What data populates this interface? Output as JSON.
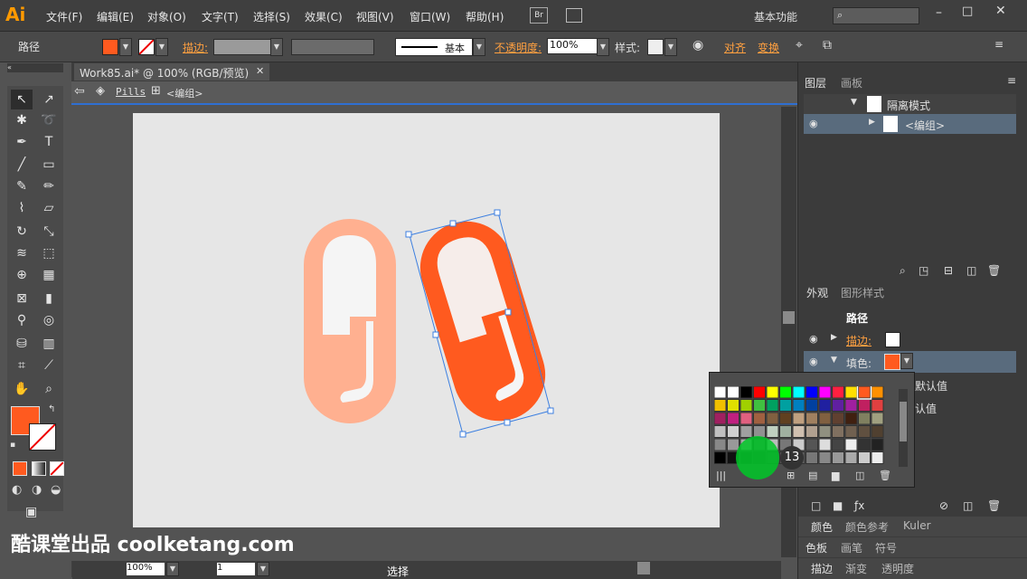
{
  "app": {
    "logo": "Ai",
    "workspace": "基本功能",
    "bridge_label": "Br"
  },
  "menu": [
    "文件(F)",
    "编辑(E)",
    "对象(O)",
    "文字(T)",
    "选择(S)",
    "效果(C)",
    "视图(V)",
    "窗口(W)",
    "帮助(H)"
  ],
  "control": {
    "object_label": "路径",
    "fill_color": "#FF5A1F",
    "stroke_label": "描边:",
    "stroke_style": "基本",
    "opacity_label": "不透明度:",
    "opacity_value": "100%",
    "style_label": "样式:",
    "align_label": "对齐",
    "transform_label": "变换"
  },
  "document": {
    "tab_title": "Work85.ai* @ 100% (RGB/预览)",
    "breadcrumb_layer": "Pills",
    "breadcrumb_group": "<编组>"
  },
  "artwork": {
    "pill_left_color": "#FFB090",
    "pill_right_color": "#FF5A1F",
    "pill_inner_color": "#F5F5F5"
  },
  "layers_panel": {
    "tabs": [
      "图层",
      "画板"
    ],
    "rows": [
      {
        "label": "隔离模式"
      },
      {
        "label": "<编组>"
      }
    ]
  },
  "appearance_panel": {
    "tabs": [
      "外观",
      "图形样式"
    ],
    "title": "路径",
    "stroke_label": "描边:",
    "fill_label": "填色:",
    "default_text": "默认值",
    "default_text2": "认值"
  },
  "swatch_popup": {
    "badge": "13"
  },
  "bottom_panels": {
    "row1": [
      "颜色",
      "颜色参考",
      "Kuler"
    ],
    "row2": [
      "色板",
      "画笔",
      "符号"
    ],
    "row3": [
      "描边",
      "渐变",
      "透明度"
    ]
  },
  "status_bar": {
    "zoom": "100%",
    "page": "1",
    "status_text": "选择"
  },
  "watermark": "酷课堂出品 coolketang.com"
}
